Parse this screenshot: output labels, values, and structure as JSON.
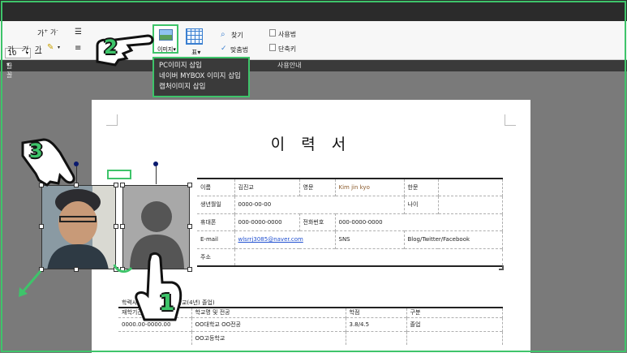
{
  "ribbon": {
    "font_size": "10",
    "bold_glyph": "가",
    "font_grow": "가",
    "font_shrink": "가",
    "image_label": "이미지",
    "table_label": "표",
    "find_label": "찾기",
    "spellcheck_label": "맞춤법",
    "usage_label": "사용법",
    "shortcut_label": "단축키",
    "group_font": "글꼴",
    "group_guide": "사용안내"
  },
  "image_menu": {
    "items": [
      "PC이미지 삽입",
      "네이버 MYBOX 이미지 삽입",
      "캡처이미지 삽입"
    ]
  },
  "document": {
    "title": "이 력 서",
    "info_rows": [
      [
        "이름",
        "김진교",
        "영문",
        "Kim jin kyo",
        "한문",
        ""
      ],
      [
        "생년월일",
        "0000-00-00",
        "",
        "",
        "나이",
        ""
      ],
      [
        "휴대폰",
        "000-0000-0000",
        "전화번호",
        "000-0000-0000",
        "",
        ""
      ],
      [
        "E-mail",
        "wlsrrj3085@naver.com",
        "SNS",
        "Blog/Twitter/Facebook",
        "",
        ""
      ],
      [
        "주소",
        "",
        "",
        "",
        "",
        ""
      ]
    ],
    "edu_section_title": "학력사항 (최종학력: 대학교(4년) 졸업)",
    "edu_headers": [
      "재학기간",
      "학교명 및 전공",
      "학점",
      "구분"
    ],
    "edu_rows": [
      [
        "0000.00-0000.00",
        "OO대학교 OO전공",
        "3.8/4.5",
        "졸업"
      ],
      [
        "",
        "OO고등학교",
        "",
        ""
      ]
    ]
  },
  "steps": [
    "1",
    "2",
    "3"
  ],
  "colors": {
    "accent_green": "#3ec46a",
    "toolbar_dark": "#2b2b2b",
    "canvas_gray": "#7a7a7a",
    "email_link": "#1f4fd0"
  }
}
